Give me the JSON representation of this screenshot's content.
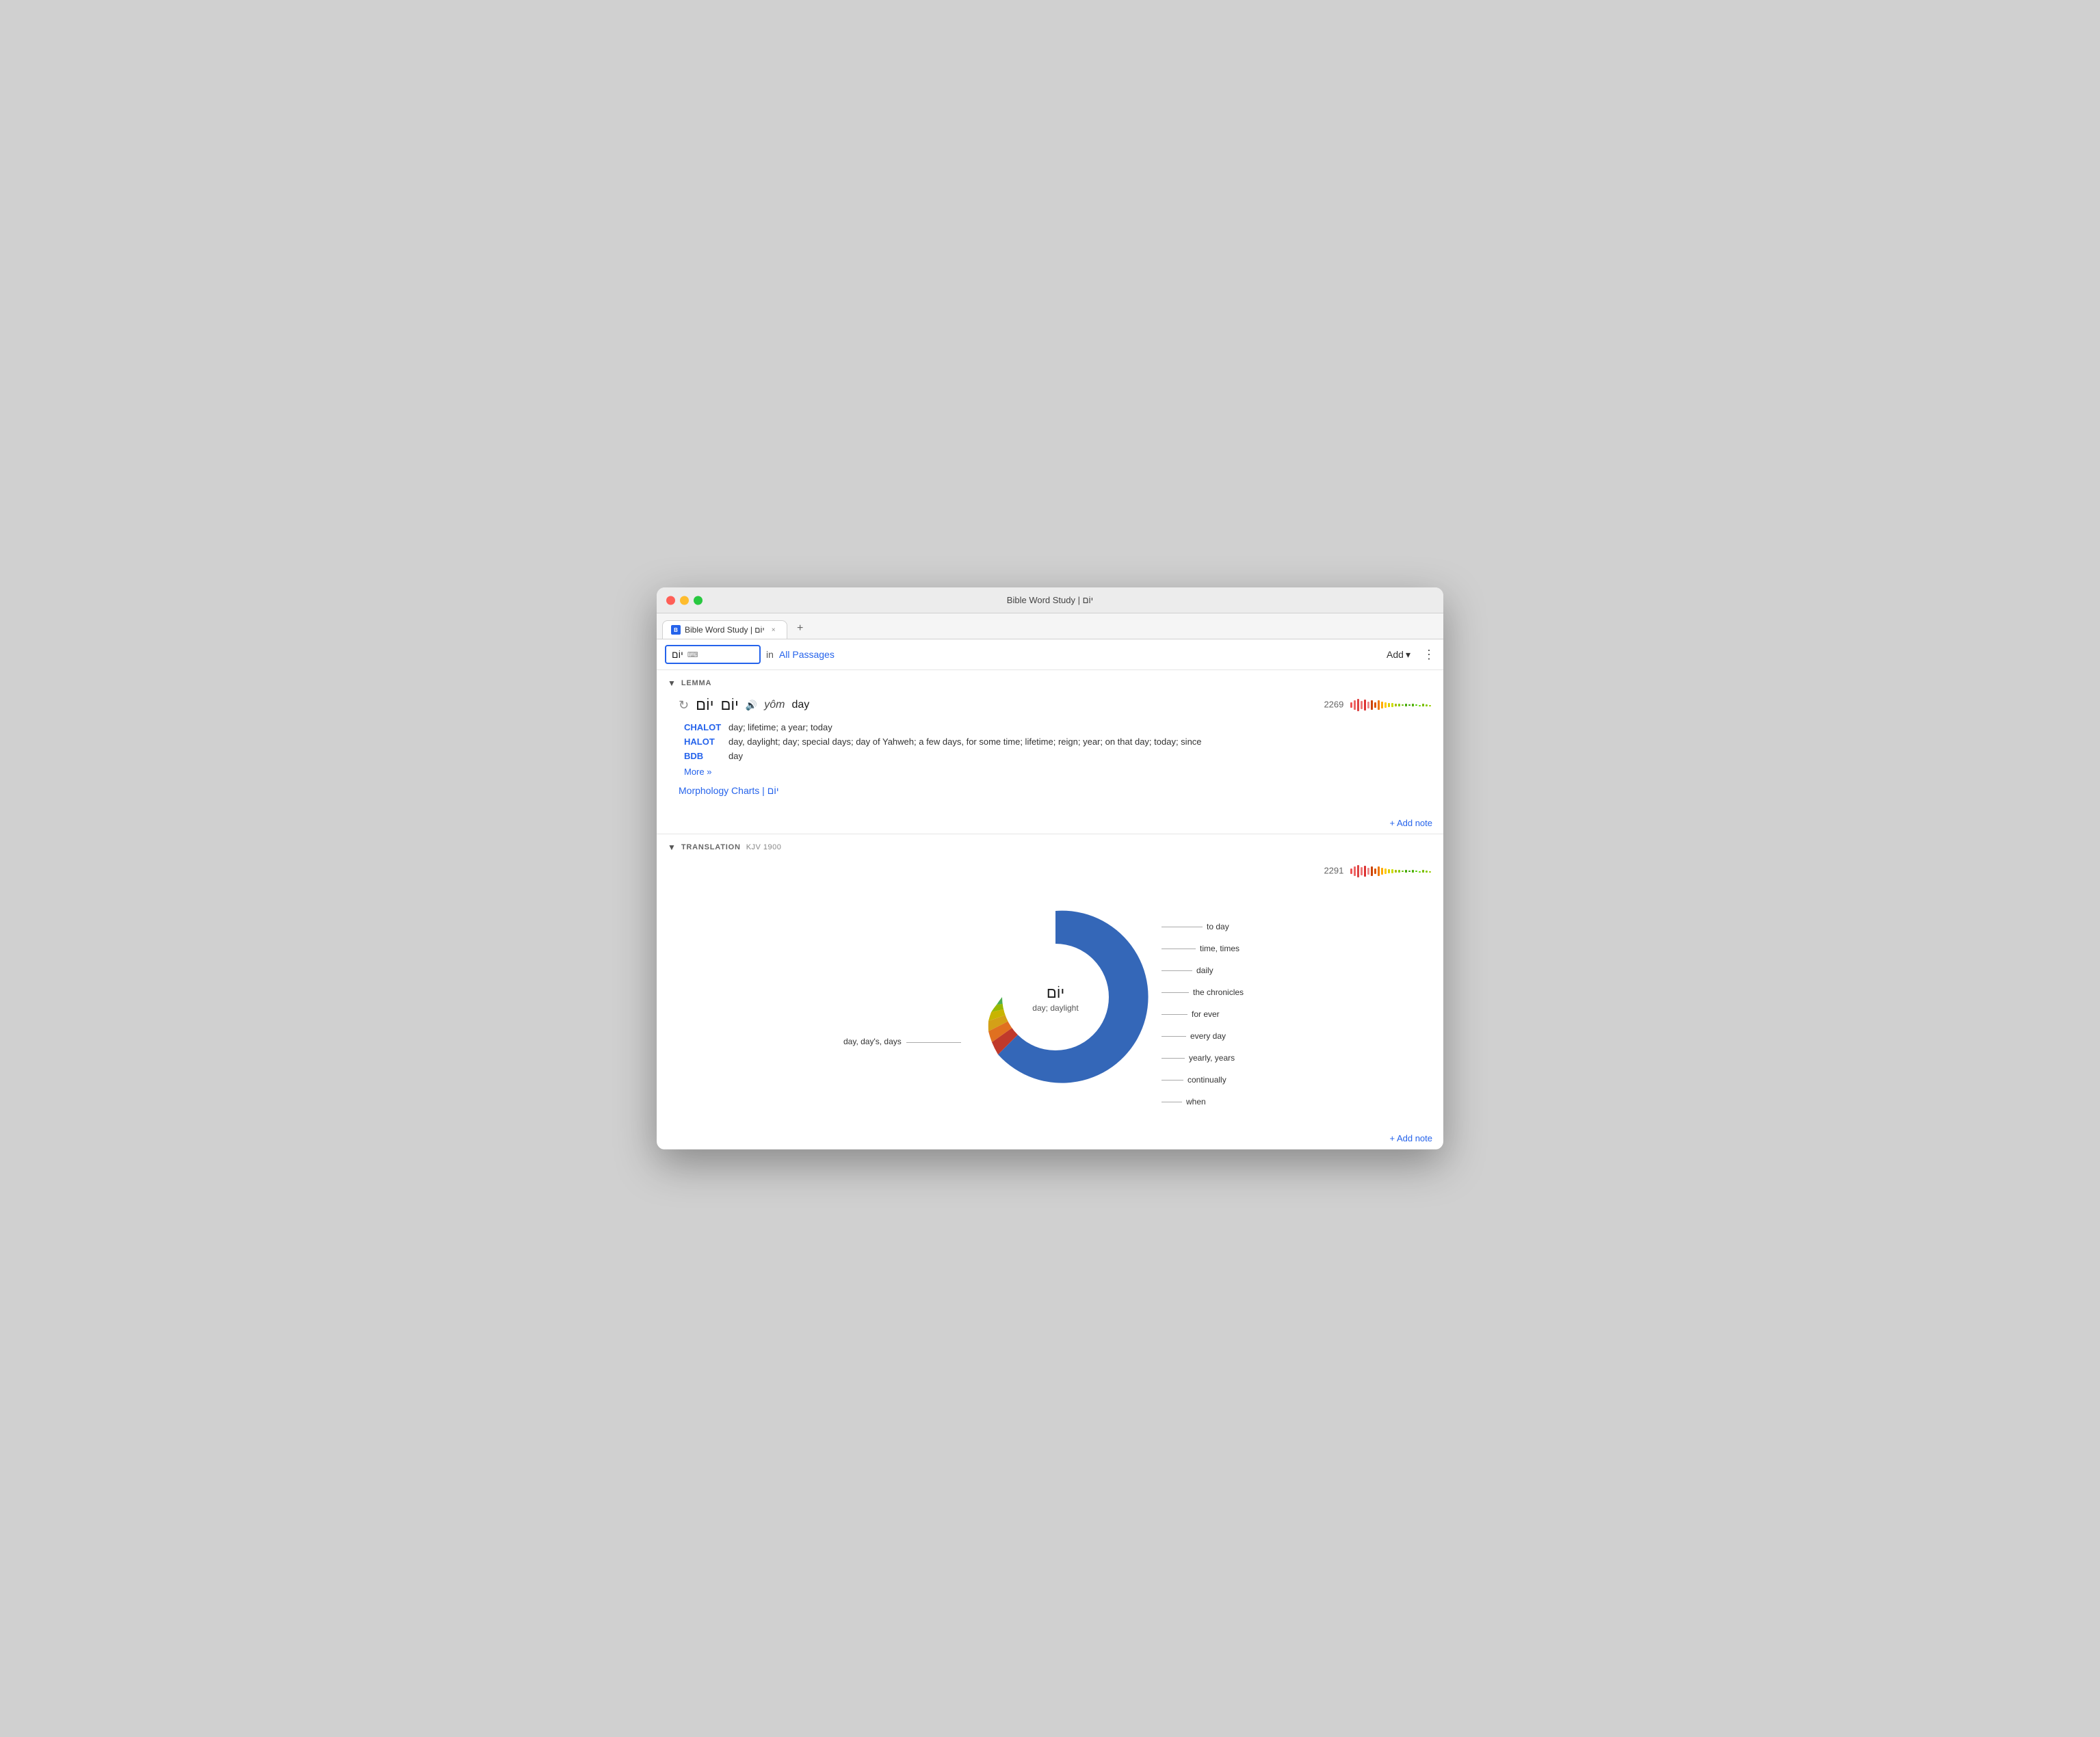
{
  "window": {
    "title": "Bible Word Study | יוֹם"
  },
  "tab": {
    "label": "Bible Word Study | יוֹם",
    "close_label": "×",
    "new_tab_label": "+"
  },
  "toolbar": {
    "search_value": "יוֹם",
    "keyboard_icon": "⌨",
    "in_label": "in",
    "all_passages": "All Passages",
    "add_label": "Add",
    "add_arrow": "▾",
    "more_icon": "⋮"
  },
  "lemma_section": {
    "title": "LEMMA",
    "refresh_icon": "↻",
    "hebrew1": "יוֹם",
    "hebrew2": "יוֹם",
    "audio_icon": "🔊",
    "transliteration": "yôm",
    "meaning": "day",
    "count": "2269",
    "chalot_label": "CHALOT",
    "chalot_text": "day; lifetime; a year; today",
    "halot_label": "HALOT",
    "halot_text": "day, daylight; day; special days; day of Yahweh; a few days, for some time; lifetime; reign; year; on that day; today; since",
    "bdb_label": "BDB",
    "bdb_text": "day",
    "more_label": "More »",
    "morphology_label": "Morphology Charts | יוֹם",
    "add_note": "+ Add note"
  },
  "translation_section": {
    "title": "TRANSLATION",
    "subtitle": "KJV 1900",
    "count": "2291",
    "add_note": "+ Add note"
  },
  "donut_chart": {
    "center_hebrew": "יוֹם",
    "center_meaning": "day; daylight",
    "segments": [
      {
        "label": "day, day's, days",
        "color": "#1e56b0",
        "value": 68,
        "position": "left"
      },
      {
        "label": "to day",
        "color": "#b0382a",
        "value": 8,
        "position": "right-top"
      },
      {
        "label": "time, times",
        "color": "#c0611a",
        "value": 4,
        "position": "right"
      },
      {
        "label": "daily",
        "color": "#d4a017",
        "value": 3,
        "position": "right"
      },
      {
        "label": "the chronicles",
        "color": "#c8b400",
        "value": 2.5,
        "position": "right"
      },
      {
        "label": "for ever",
        "color": "#98b800",
        "value": 2,
        "position": "right"
      },
      {
        "label": "every day",
        "color": "#4caf50",
        "value": 2,
        "position": "right"
      },
      {
        "label": "yearly, years",
        "color": "#009688",
        "value": 1.5,
        "position": "right"
      },
      {
        "label": "continually",
        "color": "#2196f3",
        "value": 1.5,
        "position": "right"
      },
      {
        "label": "when",
        "color": "#9c27b0",
        "value": 1,
        "position": "right"
      }
    ]
  }
}
